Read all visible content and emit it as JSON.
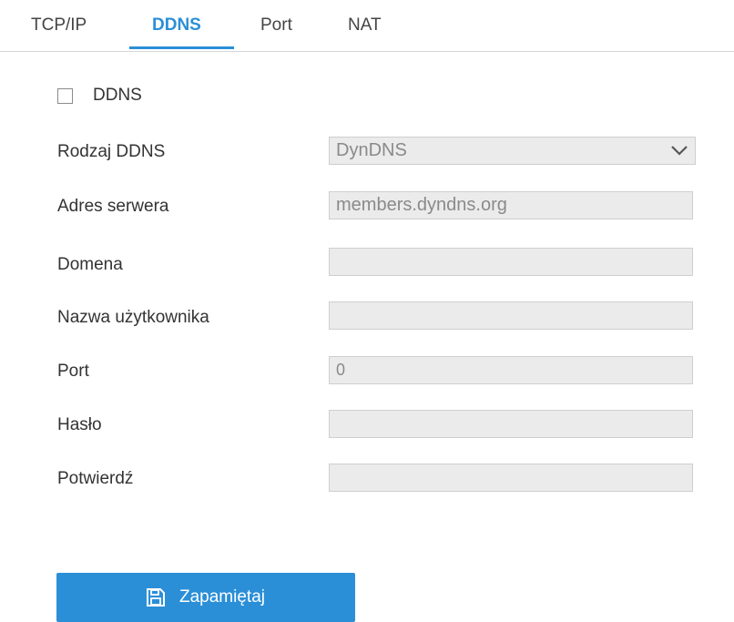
{
  "tabs": [
    {
      "label": "TCP/IP"
    },
    {
      "label": "DDNS"
    },
    {
      "label": "Port"
    },
    {
      "label": "NAT"
    }
  ],
  "active_tab": "DDNS",
  "ddns_enable": {
    "label": "DDNS",
    "checked": false
  },
  "fields": {
    "ddns_type": {
      "label": "Rodzaj DDNS",
      "value": "DynDNS",
      "icon": "chevron-down-icon"
    },
    "server_address": {
      "label": "Adres serwera",
      "value": "members.dyndns.org"
    },
    "domain": {
      "label": "Domena",
      "value": ""
    },
    "username": {
      "label": "Nazwa użytkownika",
      "value": ""
    },
    "port": {
      "label": "Port",
      "value": "0"
    },
    "password": {
      "label": "Hasło",
      "value": ""
    },
    "confirm": {
      "label": "Potwierdź",
      "value": ""
    }
  },
  "save_button": {
    "label": "Zapamiętaj",
    "icon": "save-icon"
  },
  "colors": {
    "accent": "#2b8fd8",
    "input_bg": "#ebebeb",
    "input_text": "#8a8a8a"
  }
}
